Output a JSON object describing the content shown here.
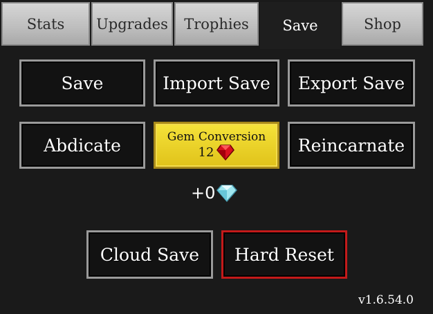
{
  "tabs": [
    {
      "label": "Stats"
    },
    {
      "label": "Upgrades"
    },
    {
      "label": "Trophies"
    },
    {
      "label": "Save"
    },
    {
      "label": "Shop"
    }
  ],
  "active_tab": "Save",
  "buttons": {
    "save": "Save",
    "import_save": "Import Save",
    "export_save": "Export Save",
    "abdicate": "Abdicate",
    "gem_conversion_title": "Gem Conversion",
    "gem_conversion_count": "12",
    "reincarnate": "Reincarnate",
    "cloud_save": "Cloud Save",
    "hard_reset": "Hard Reset"
  },
  "gain_text": "+0",
  "version": "v1.6.54.0",
  "icons": {
    "gem_conversion": "ruby-icon",
    "gain": "diamond-icon"
  },
  "colors": {
    "gem_button": "#e8c822",
    "hard_reset_border": "#c41a1a"
  }
}
